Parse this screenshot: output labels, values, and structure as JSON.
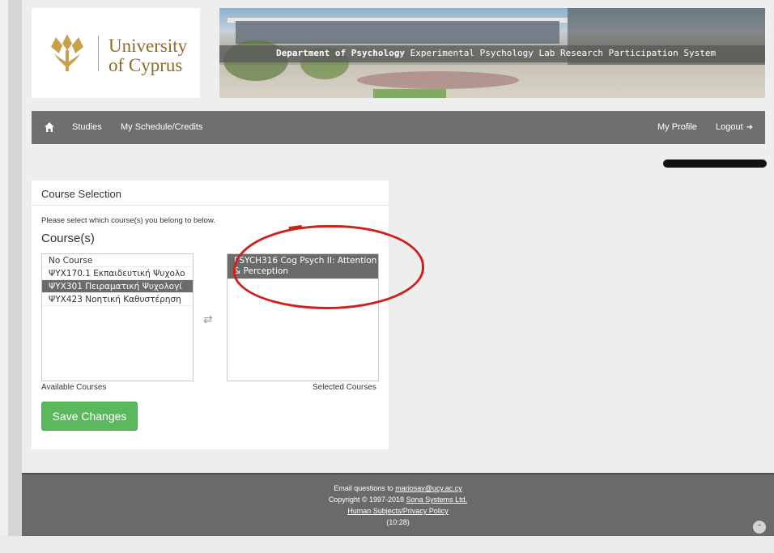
{
  "logo": {
    "line1": "University",
    "line2": "of Cyprus"
  },
  "banner": {
    "title_bold": "Department of Psychology",
    "title_rest": " Experimental Psychology Lab Research Participation System"
  },
  "nav": {
    "home_icon": "home-icon",
    "studies": "Studies",
    "schedule": "My Schedule/Credits",
    "profile": "My Profile",
    "logout": "Logout",
    "logout_icon": "sign-out-icon"
  },
  "panel": {
    "title": "Course Selection",
    "instruction": "Please select which course(s) you belong to below.",
    "heading": "Course(s)",
    "available_label": "Available Courses",
    "selected_label": "Selected Courses",
    "save_label": "Save Changes",
    "available_courses": [
      {
        "label": "No Course",
        "selected": false
      },
      {
        "label": "ΨΥΧ170.1 Εκπαιδευτική Ψυχολο",
        "selected": false
      },
      {
        "label": "ΨΥΧ301 Πειραματική Ψυχολογί",
        "selected": true
      },
      {
        "label": "ΨΥΧ423 Νοητική Καθυστέρηση",
        "selected": false
      }
    ],
    "selected_courses": [
      {
        "label": "PSYCH316 Cog Psych II: Attention & Perception",
        "selected": true
      }
    ],
    "swap_icon": "swap-arrows-icon"
  },
  "footer": {
    "email_prefix": "Email questions to ",
    "email": "mariosav@ucy.ac.cy",
    "copyright_prefix": "Copyright © 1997-2018 ",
    "company": "Sona Systems Ltd.",
    "policy": "Human Subjects/Privacy Policy",
    "time": "(10:28)"
  },
  "colors": {
    "navbar": "#6f6f6f",
    "save_button": "#5cb85c",
    "selected_option": "#6b6b6b",
    "annotation": "#d0201c",
    "logo_gold": "#c9a14a"
  }
}
